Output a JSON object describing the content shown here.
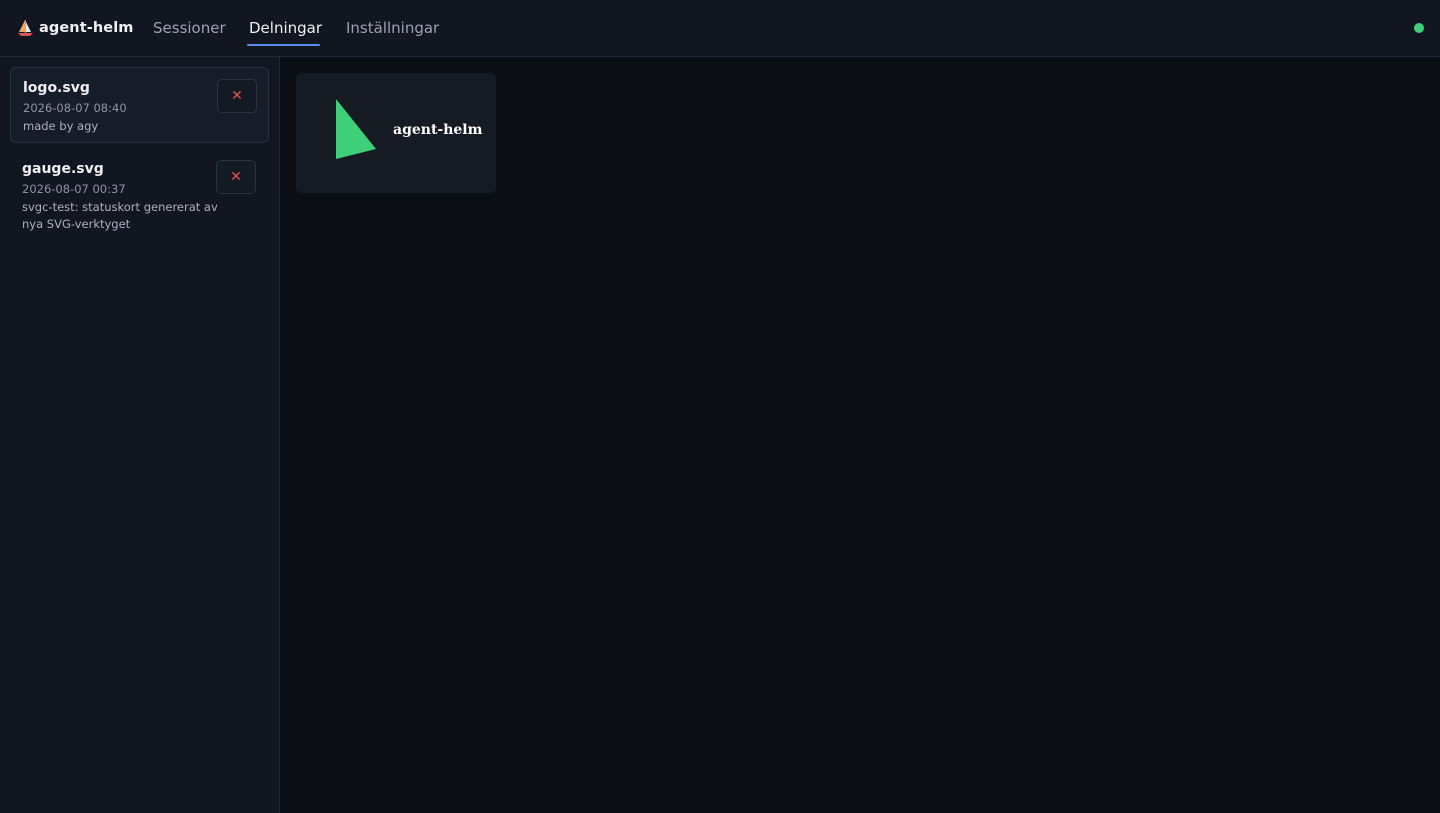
{
  "app": {
    "name": "agent-helm",
    "icon": "sailboat-icon"
  },
  "nav": {
    "tabs": [
      {
        "label": "Sessioner",
        "active": false
      },
      {
        "label": "Delningar",
        "active": true
      },
      {
        "label": "Inställningar",
        "active": false
      }
    ]
  },
  "status": {
    "icon": "status-dot-icon",
    "color": "#3ecf78"
  },
  "shares": [
    {
      "name": "logo.svg",
      "date": "2026-08-07 08:40",
      "description": "made by agy",
      "selected": true,
      "delete_label": "✕"
    },
    {
      "name": "gauge.svg",
      "date": "2026-08-07 00:37",
      "description": "svgc-test: statuskort genererat av nya SVG-verktyget",
      "selected": false,
      "delete_label": "✕"
    }
  ],
  "preview": {
    "logo_text": "agent-helm",
    "logo_color": "#3ecf78"
  },
  "colors": {
    "accent": "#5b8def",
    "danger": "#e5534b",
    "success": "#3ecf78"
  }
}
